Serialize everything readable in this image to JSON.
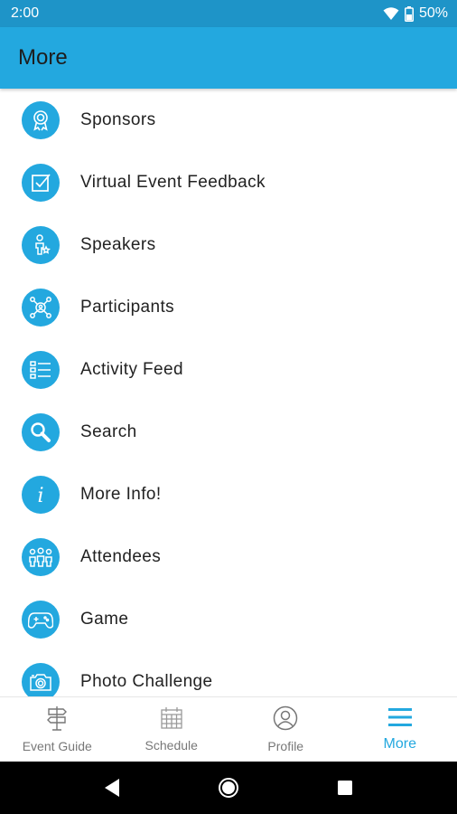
{
  "status_bar": {
    "time": "2:00",
    "battery": "50%",
    "icons": [
      "wifi-icon",
      "battery-icon"
    ]
  },
  "app_bar": {
    "title": "More"
  },
  "theme": {
    "accent": "#23a8df",
    "status_bar": "#1e94c8"
  },
  "menu": {
    "items": [
      {
        "label": "Sponsors",
        "icon": "ribbon-award-icon"
      },
      {
        "label": "Virtual Event Feedback",
        "icon": "checkbox-icon"
      },
      {
        "label": "Speakers",
        "icon": "speaker-icon"
      },
      {
        "label": "Participants",
        "icon": "network-icon"
      },
      {
        "label": "Activity Feed",
        "icon": "list-icon"
      },
      {
        "label": "Search",
        "icon": "search-icon"
      },
      {
        "label": "More Info!",
        "icon": "info-icon"
      },
      {
        "label": "Attendees",
        "icon": "group-icon"
      },
      {
        "label": "Game",
        "icon": "gamepad-icon"
      },
      {
        "label": "Photo Challenge",
        "icon": "camera-icon"
      }
    ]
  },
  "bottom_nav": {
    "items": [
      {
        "label": "Event Guide",
        "icon": "signpost-icon"
      },
      {
        "label": "Schedule",
        "icon": "calendar-icon"
      },
      {
        "label": "Profile",
        "icon": "profile-icon"
      },
      {
        "label": "More",
        "icon": "menu-icon",
        "active": true
      }
    ]
  }
}
